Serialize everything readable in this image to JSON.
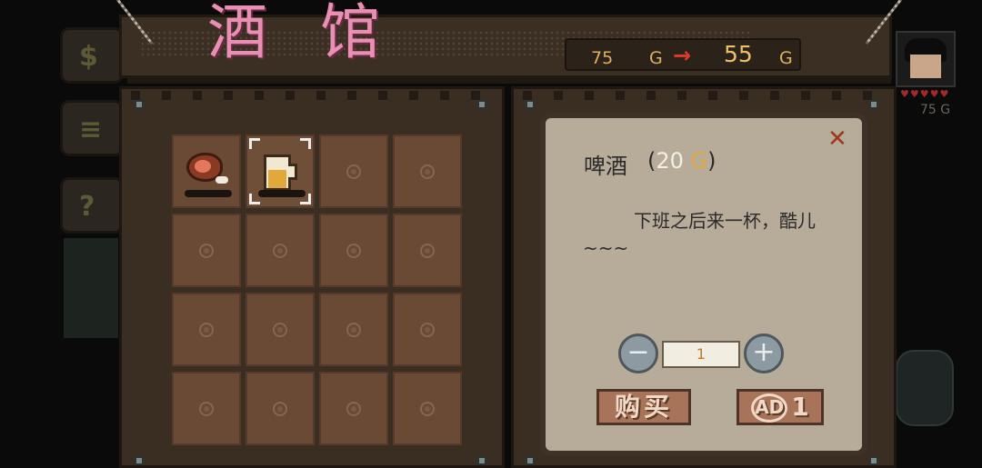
{
  "header": {
    "title": "酒馆",
    "price_from": "75",
    "price_to": "55",
    "currency": "G",
    "arrow": "→"
  },
  "hud": {
    "gold": "75 G",
    "hearts": "♥♥♥♥♥"
  },
  "inventory": {
    "slots": [
      {
        "item": "meat",
        "selected": false
      },
      {
        "item": "beer",
        "selected": true
      },
      {
        "item": null
      },
      {
        "item": null
      },
      {
        "item": null
      },
      {
        "item": null
      },
      {
        "item": null
      },
      {
        "item": null
      },
      {
        "item": null
      },
      {
        "item": null
      },
      {
        "item": null
      },
      {
        "item": null
      },
      {
        "item": null
      },
      {
        "item": null
      },
      {
        "item": null
      },
      {
        "item": null
      }
    ]
  },
  "detail": {
    "name": "啤酒",
    "price": "20",
    "currency": "G",
    "description": "下班之后来一杯，酷儿~~~",
    "quantity": "1",
    "minus": "−",
    "plus": "+",
    "buy_label": "购买",
    "ad_icon": "AD",
    "ad_count": "1",
    "close": "✕"
  },
  "colors": {
    "title": "#e88fb4",
    "gold": "#e0b15a",
    "arrow": "#e23a2a",
    "card": "#b7ab99"
  }
}
